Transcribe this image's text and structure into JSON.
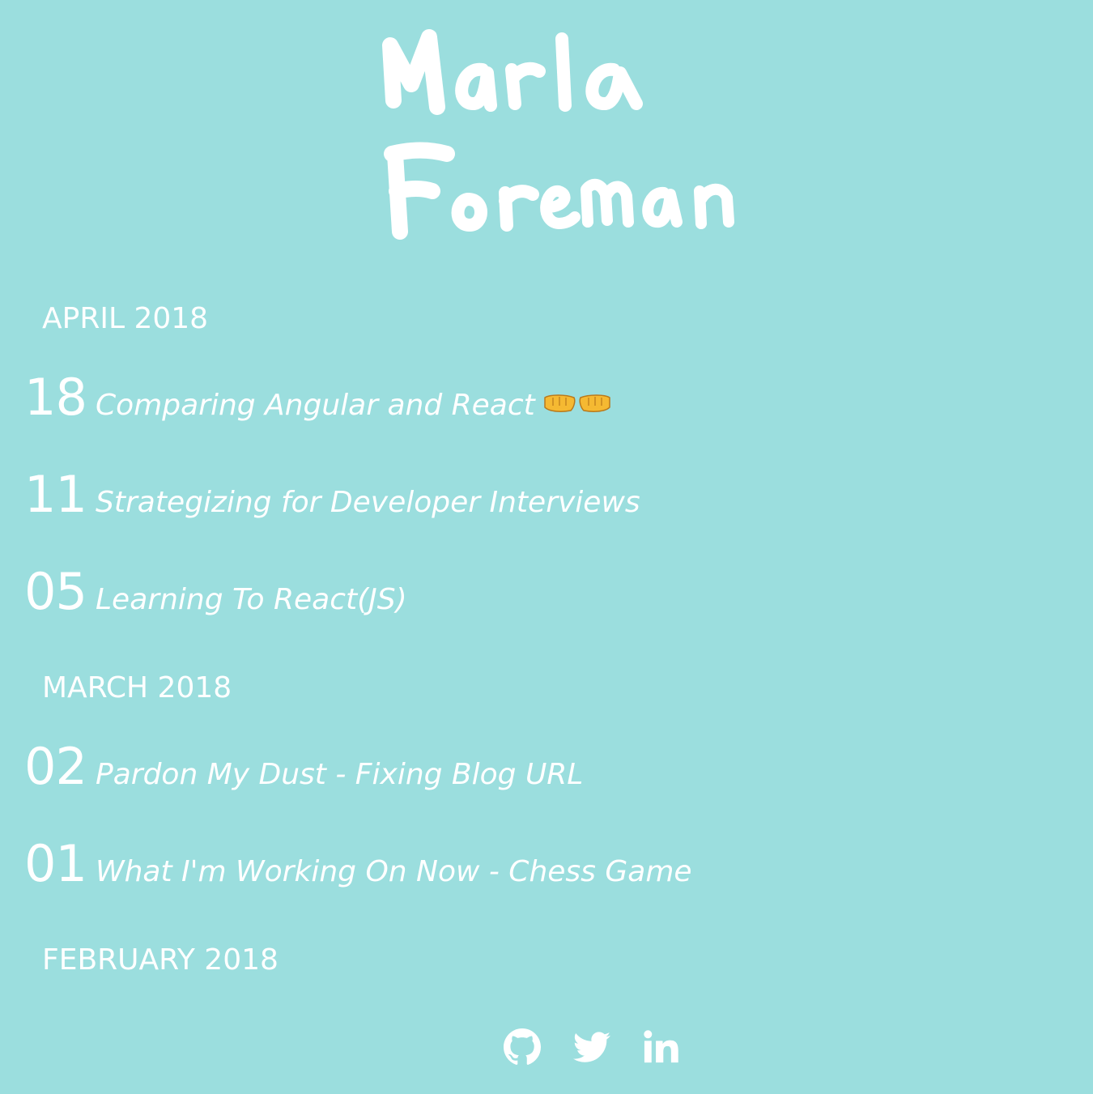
{
  "site": {
    "logo_text_line1": "Marla",
    "logo_text_line2": "Foreman"
  },
  "archive": [
    {
      "month": "APRIL 2018",
      "posts": [
        {
          "day": "18",
          "title": "Comparing Angular and React",
          "emoji": "left-fist-right-fist-emoji"
        },
        {
          "day": "11",
          "title": "Strategizing for Developer Interviews"
        },
        {
          "day": "05",
          "title": "Learning To React(JS)"
        }
      ]
    },
    {
      "month": "MARCH 2018",
      "posts": [
        {
          "day": "02",
          "title": "Pardon My Dust - Fixing Blog URL"
        },
        {
          "day": "01",
          "title": "What I'm Working On Now - Chess Game"
        }
      ]
    },
    {
      "month": "FEBRUARY 2018",
      "posts": []
    }
  ],
  "social": [
    {
      "icon": "github-icon"
    },
    {
      "icon": "twitter-icon"
    },
    {
      "icon": "linkedin-icon"
    }
  ],
  "colors": {
    "background": "#9bdede",
    "text": "#ffffff",
    "emoji_fist": "#f5b932"
  }
}
